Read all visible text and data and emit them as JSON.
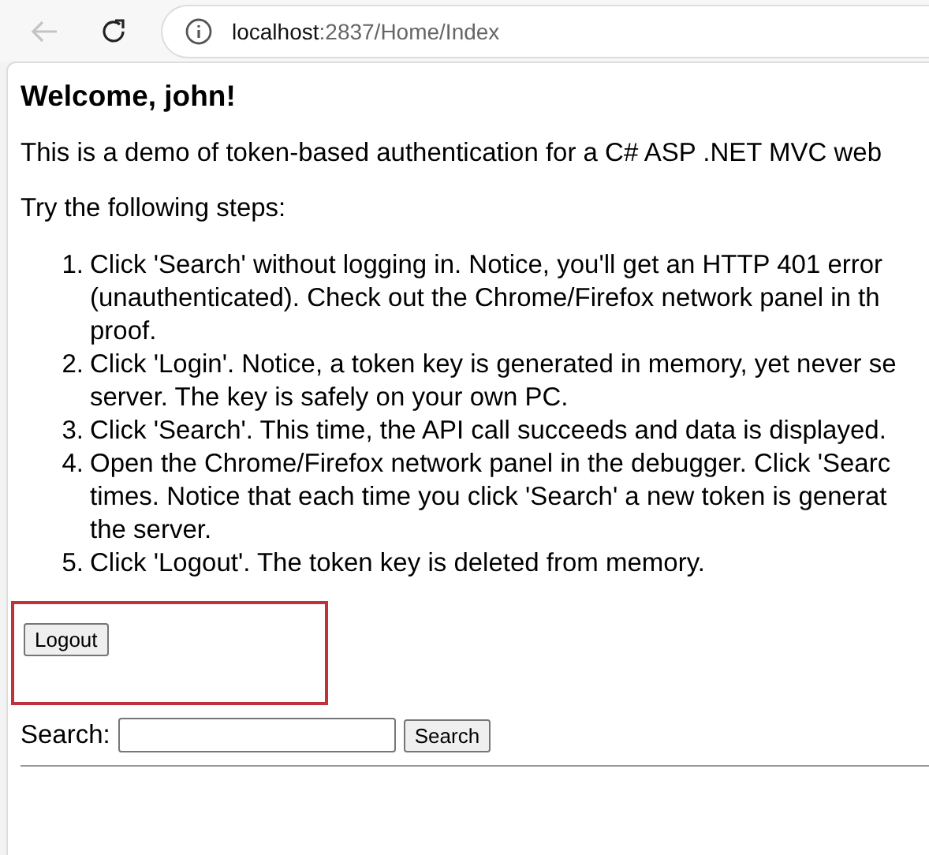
{
  "browser": {
    "url_host": "localhost",
    "url_path": ":2837/Home/Index",
    "back_disabled": true
  },
  "page": {
    "heading": "Welcome, john!",
    "intro": "This is a demo of token-based authentication for a C# ASP .NET MVC web",
    "steps_label": "Try the following steps:",
    "steps": [
      {
        "number": "1.",
        "lines": [
          "Click 'Search' without logging in. Notice, you'll get an HTTP 401 error",
          "(unauthenticated). Check out the Chrome/Firefox network panel in th",
          "proof."
        ]
      },
      {
        "number": "2.",
        "lines": [
          "Click 'Login'. Notice, a token key is generated in memory, yet never se",
          "server. The key is safely on your own PC."
        ]
      },
      {
        "number": "3.",
        "lines": [
          "Click 'Search'. This time, the API call succeeds and data is displayed."
        ]
      },
      {
        "number": "4.",
        "lines": [
          "Open the Chrome/Firefox network panel in the debugger. Click 'Searc",
          "times. Notice that each time you click 'Search' a new token is generat",
          "the server."
        ]
      },
      {
        "number": "5.",
        "lines": [
          "Click 'Logout'. The token key is deleted from memory."
        ]
      }
    ],
    "logout_button": "Logout",
    "logout_highlighted": true,
    "search_label": "Search:",
    "search_button": "Search"
  }
}
